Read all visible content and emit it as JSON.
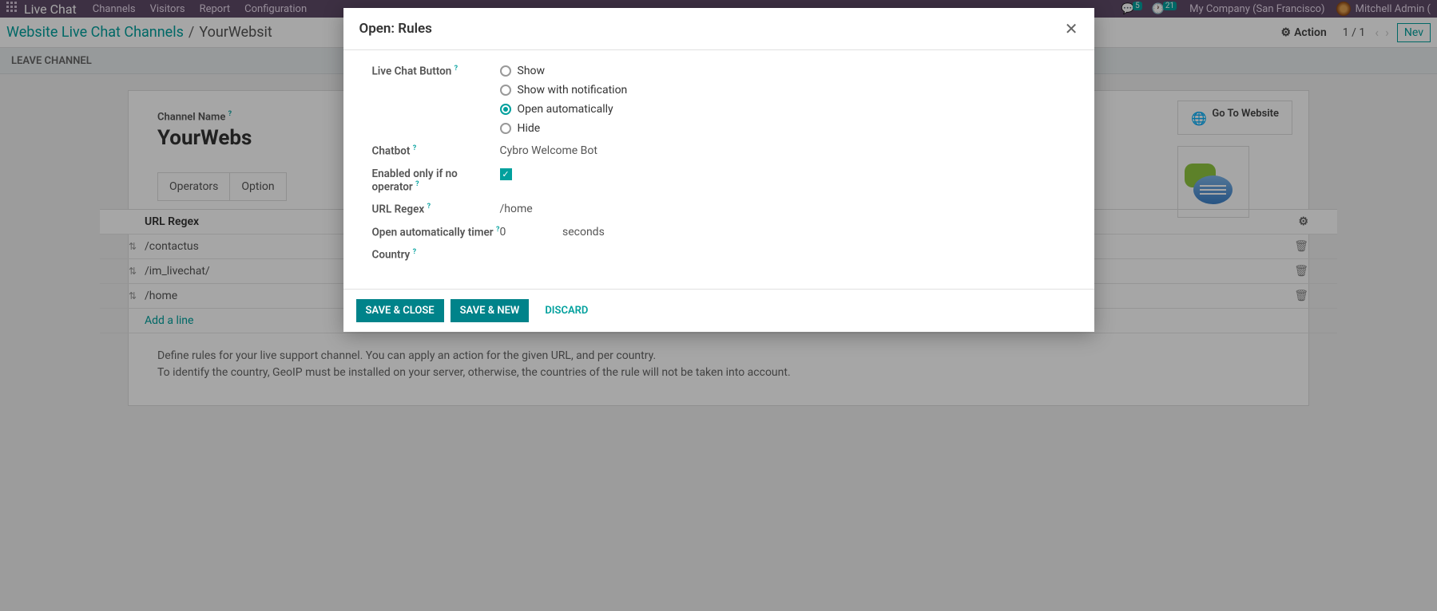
{
  "topbar": {
    "brand": "Live Chat",
    "menus": [
      "Channels",
      "Visitors",
      "Report",
      "Configuration"
    ],
    "msg_badge": "5",
    "clock_badge": "21",
    "company": "My Company (San Francisco)",
    "user": "Mitchell Admin ("
  },
  "breadcrumb": {
    "root": "Website Live Chat Channels",
    "current": "YourWebsit",
    "action_label": "Action",
    "pager": "1 / 1",
    "new_label": "Nev"
  },
  "subbar": {
    "leave": "LEAVE CHANNEL"
  },
  "sheet": {
    "go_website": "Go To Website",
    "channel_name_label": "Channel Name",
    "channel_name": "YourWebs",
    "tabs": [
      "Operators",
      "Option"
    ],
    "table": {
      "header": "URL Regex",
      "rows": [
        "/contactus",
        "/im_livechat/",
        "/home"
      ],
      "add_line": "Add a line"
    },
    "help1": "Define rules for your live support channel. You can apply an action for the given URL, and per country.",
    "help2": "To identify the country, GeoIP must be installed on your server, otherwise, the countries of the rule will not be taken into account."
  },
  "modal": {
    "title": "Open: Rules",
    "labels": {
      "button": "Live Chat Button",
      "chatbot": "Chatbot",
      "enabled_only": "Enabled only if no operator",
      "url_regex": "URL Regex",
      "timer": "Open automatically timer",
      "country": "Country"
    },
    "options": {
      "show": "Show",
      "show_notif": "Show with notification",
      "open_auto": "Open automatically",
      "hide": "Hide"
    },
    "values": {
      "chatbot": "Cybro Welcome Bot",
      "url_regex": "/home",
      "timer": "0",
      "timer_unit": "seconds"
    },
    "footer": {
      "save_close": "SAVE & CLOSE",
      "save_new": "SAVE & NEW",
      "discard": "DISCARD"
    }
  }
}
